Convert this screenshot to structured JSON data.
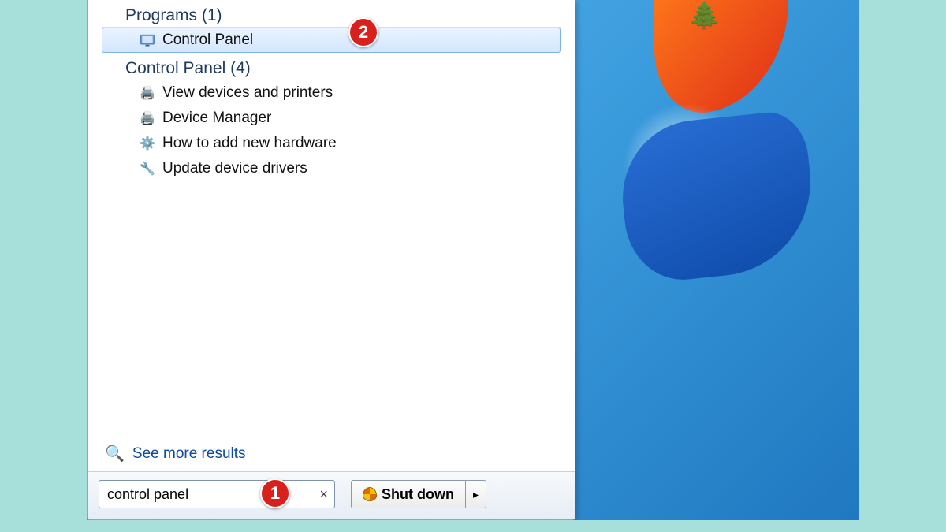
{
  "sections": {
    "programs": {
      "header": "Programs (1)"
    },
    "controlpanel": {
      "header": "Control Panel (4)"
    }
  },
  "results": {
    "programs_item": "Control Panel",
    "cp0": "View devices and printers",
    "cp1": "Device Manager",
    "cp2": "How to add new hardware",
    "cp3": "Update device drivers"
  },
  "see_more": "See more results",
  "search": {
    "value": "control panel"
  },
  "shutdown": {
    "label": "Shut down",
    "arrow": "▸"
  },
  "annotations": {
    "one": "1",
    "two": "2"
  }
}
